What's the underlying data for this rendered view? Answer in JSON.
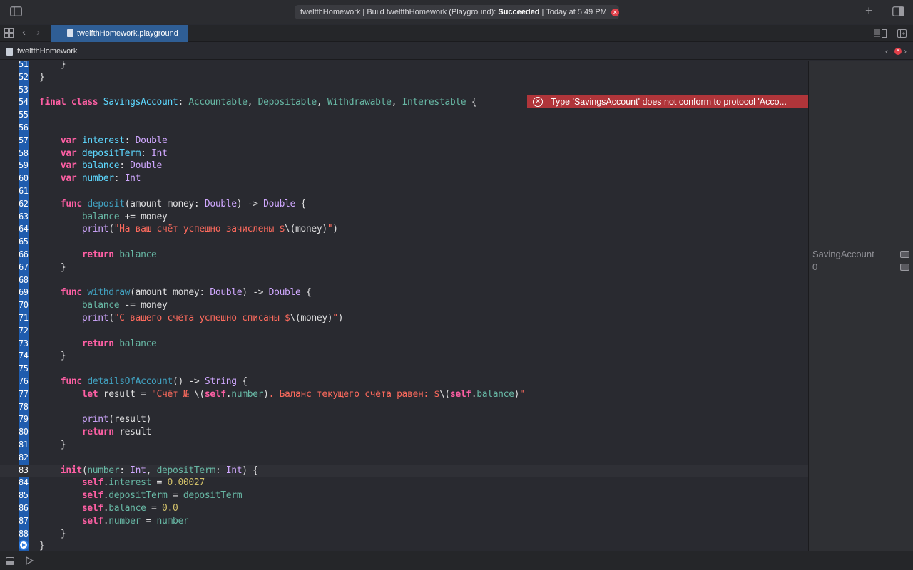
{
  "toolbar": {
    "sidebar_icon": "sidebar-toggle-icon",
    "status_prefix": "twelfthHomework | Build twelfthHomework (Playground): ",
    "status_result": "Succeeded",
    "status_time": " | Today at 5:49 PM",
    "error_count": "1",
    "add_icon": "plus-icon",
    "inspector_icon": "inspector-toggle-icon"
  },
  "tabbar": {
    "active_tab": "twelfthHomework.playground"
  },
  "jumpbar": {
    "crumb": "twelfthHomework"
  },
  "editor": {
    "error_message": "Type 'SavingsAccount' does not conform to protocol 'Acco...",
    "lines": [
      {
        "n": "51",
        "code": "    }"
      },
      {
        "n": "52",
        "code": "}"
      },
      {
        "n": "53",
        "code": ""
      },
      {
        "n": "54",
        "code": "final class SavingsAccount: Accountable, Depositable, Withdrawable, Interestable {"
      },
      {
        "n": "55",
        "code": ""
      },
      {
        "n": "56",
        "code": ""
      },
      {
        "n": "57",
        "code": "    var interest: Double"
      },
      {
        "n": "58",
        "code": "    var depositTerm: Int"
      },
      {
        "n": "59",
        "code": "    var balance: Double"
      },
      {
        "n": "60",
        "code": "    var number: Int"
      },
      {
        "n": "61",
        "code": ""
      },
      {
        "n": "62",
        "code": "    func deposit(amount money: Double) -> Double {"
      },
      {
        "n": "63",
        "code": "        balance += money"
      },
      {
        "n": "64",
        "code": "        print(\"На ваш счёт успешно зачислены $\\(money)\")"
      },
      {
        "n": "65",
        "code": ""
      },
      {
        "n": "66",
        "code": "        return balance"
      },
      {
        "n": "67",
        "code": "    }"
      },
      {
        "n": "68",
        "code": ""
      },
      {
        "n": "69",
        "code": "    func withdraw(amount money: Double) -> Double {"
      },
      {
        "n": "70",
        "code": "        balance -= money"
      },
      {
        "n": "71",
        "code": "        print(\"С вашего счёта успешно списаны $\\(money)\")"
      },
      {
        "n": "72",
        "code": ""
      },
      {
        "n": "73",
        "code": "        return balance"
      },
      {
        "n": "74",
        "code": "    }"
      },
      {
        "n": "75",
        "code": ""
      },
      {
        "n": "76",
        "code": "    func detailsOfAccount() -> String {"
      },
      {
        "n": "77",
        "code": "        let result = \"Счёт № \\(self.number). Баланс текущего счёта равен: $\\(self.balance)\""
      },
      {
        "n": "78",
        "code": ""
      },
      {
        "n": "79",
        "code": "        print(result)"
      },
      {
        "n": "80",
        "code": "        return result"
      },
      {
        "n": "81",
        "code": "    }"
      },
      {
        "n": "82",
        "code": ""
      },
      {
        "n": "83",
        "code": "    init(number: Int, depositTerm: Int) {"
      },
      {
        "n": "84",
        "code": "        self.interest = 0.00027"
      },
      {
        "n": "85",
        "code": "        self.depositTerm = depositTerm"
      },
      {
        "n": "86",
        "code": "        self.balance = 0.0"
      },
      {
        "n": "87",
        "code": "        self.number = number"
      },
      {
        "n": "88",
        "code": "    }"
      },
      {
        "n": "",
        "code": "}"
      }
    ]
  },
  "results": {
    "rows": [
      "SavingAccount",
      "0"
    ]
  },
  "colors": {
    "keyword": "#fc5fa3",
    "type": "#d0a8ff",
    "string": "#fc6a5d",
    "number": "#d0bf69",
    "run_bar": "#1f5cae",
    "error": "#b0353a"
  }
}
